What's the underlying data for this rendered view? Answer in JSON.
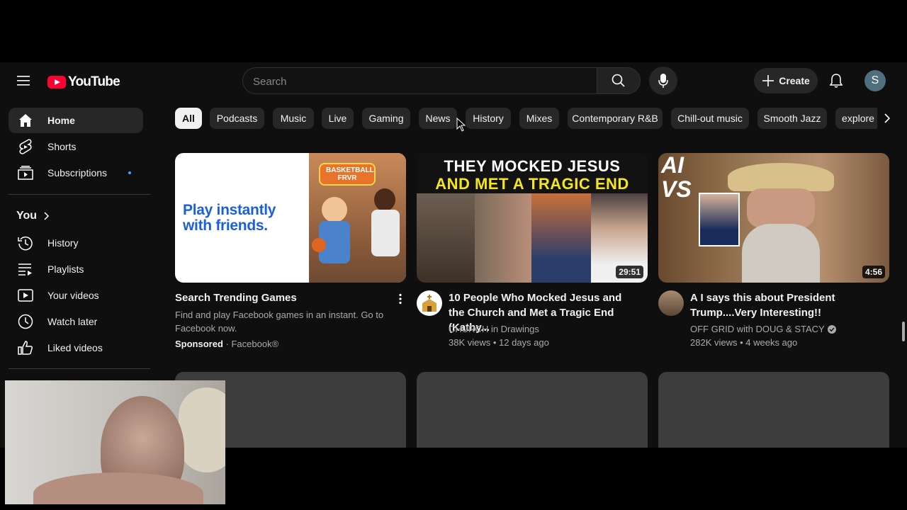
{
  "header": {
    "logo_text": "YouTube",
    "search_placeholder": "Search",
    "create_label": "Create",
    "avatar_letter": "S"
  },
  "sidebar": {
    "items": [
      {
        "label": "Home",
        "icon": "home-icon"
      },
      {
        "label": "Shorts",
        "icon": "shorts-icon"
      },
      {
        "label": "Subscriptions",
        "icon": "subscriptions-icon"
      }
    ],
    "you_label": "You",
    "you_items": [
      {
        "label": "History",
        "icon": "history-icon"
      },
      {
        "label": "Playlists",
        "icon": "playlists-icon"
      },
      {
        "label": "Your videos",
        "icon": "your-videos-icon"
      },
      {
        "label": "Watch later",
        "icon": "watch-later-icon"
      },
      {
        "label": "Liked videos",
        "icon": "liked-videos-icon"
      }
    ]
  },
  "chips": [
    "All",
    "Podcasts",
    "Music",
    "Live",
    "Gaming",
    "News",
    "History",
    "Mixes",
    "Contemporary R&B",
    "Chill-out music",
    "Smooth Jazz",
    "explore"
  ],
  "videos": [
    {
      "title": "Search Trending Games",
      "description": "Find and play Facebook games in an instant. Go to Facebook now.",
      "sponsored": "Sponsored",
      "advertiser": "· Facebook®",
      "thumb_text": "Play instantly with friends.",
      "thumb_badge": "BASKETBALL FRVR"
    },
    {
      "title": "10 People Who Mocked Jesus and the Church and Met a Tragic End (Kathy...",
      "channel": "CHURCH in Drawings",
      "stats": "38K views • 12 days ago",
      "duration": "29:51",
      "thumb_line1": "THEY MOCKED JESUS",
      "thumb_line2": "AND MET A TRAGIC END"
    },
    {
      "title": "A I says this about President Trump....Very Interesting!!",
      "channel": "OFF GRID with DOUG & STACY",
      "stats": "282K views • 4 weeks ago",
      "duration": "4:56",
      "thumb_text": "AI VS"
    }
  ],
  "colors": {
    "background": "#0f0f0f",
    "brand": "#ff0033",
    "chip": "#272727",
    "notification_dot": "#3ea6ff"
  }
}
